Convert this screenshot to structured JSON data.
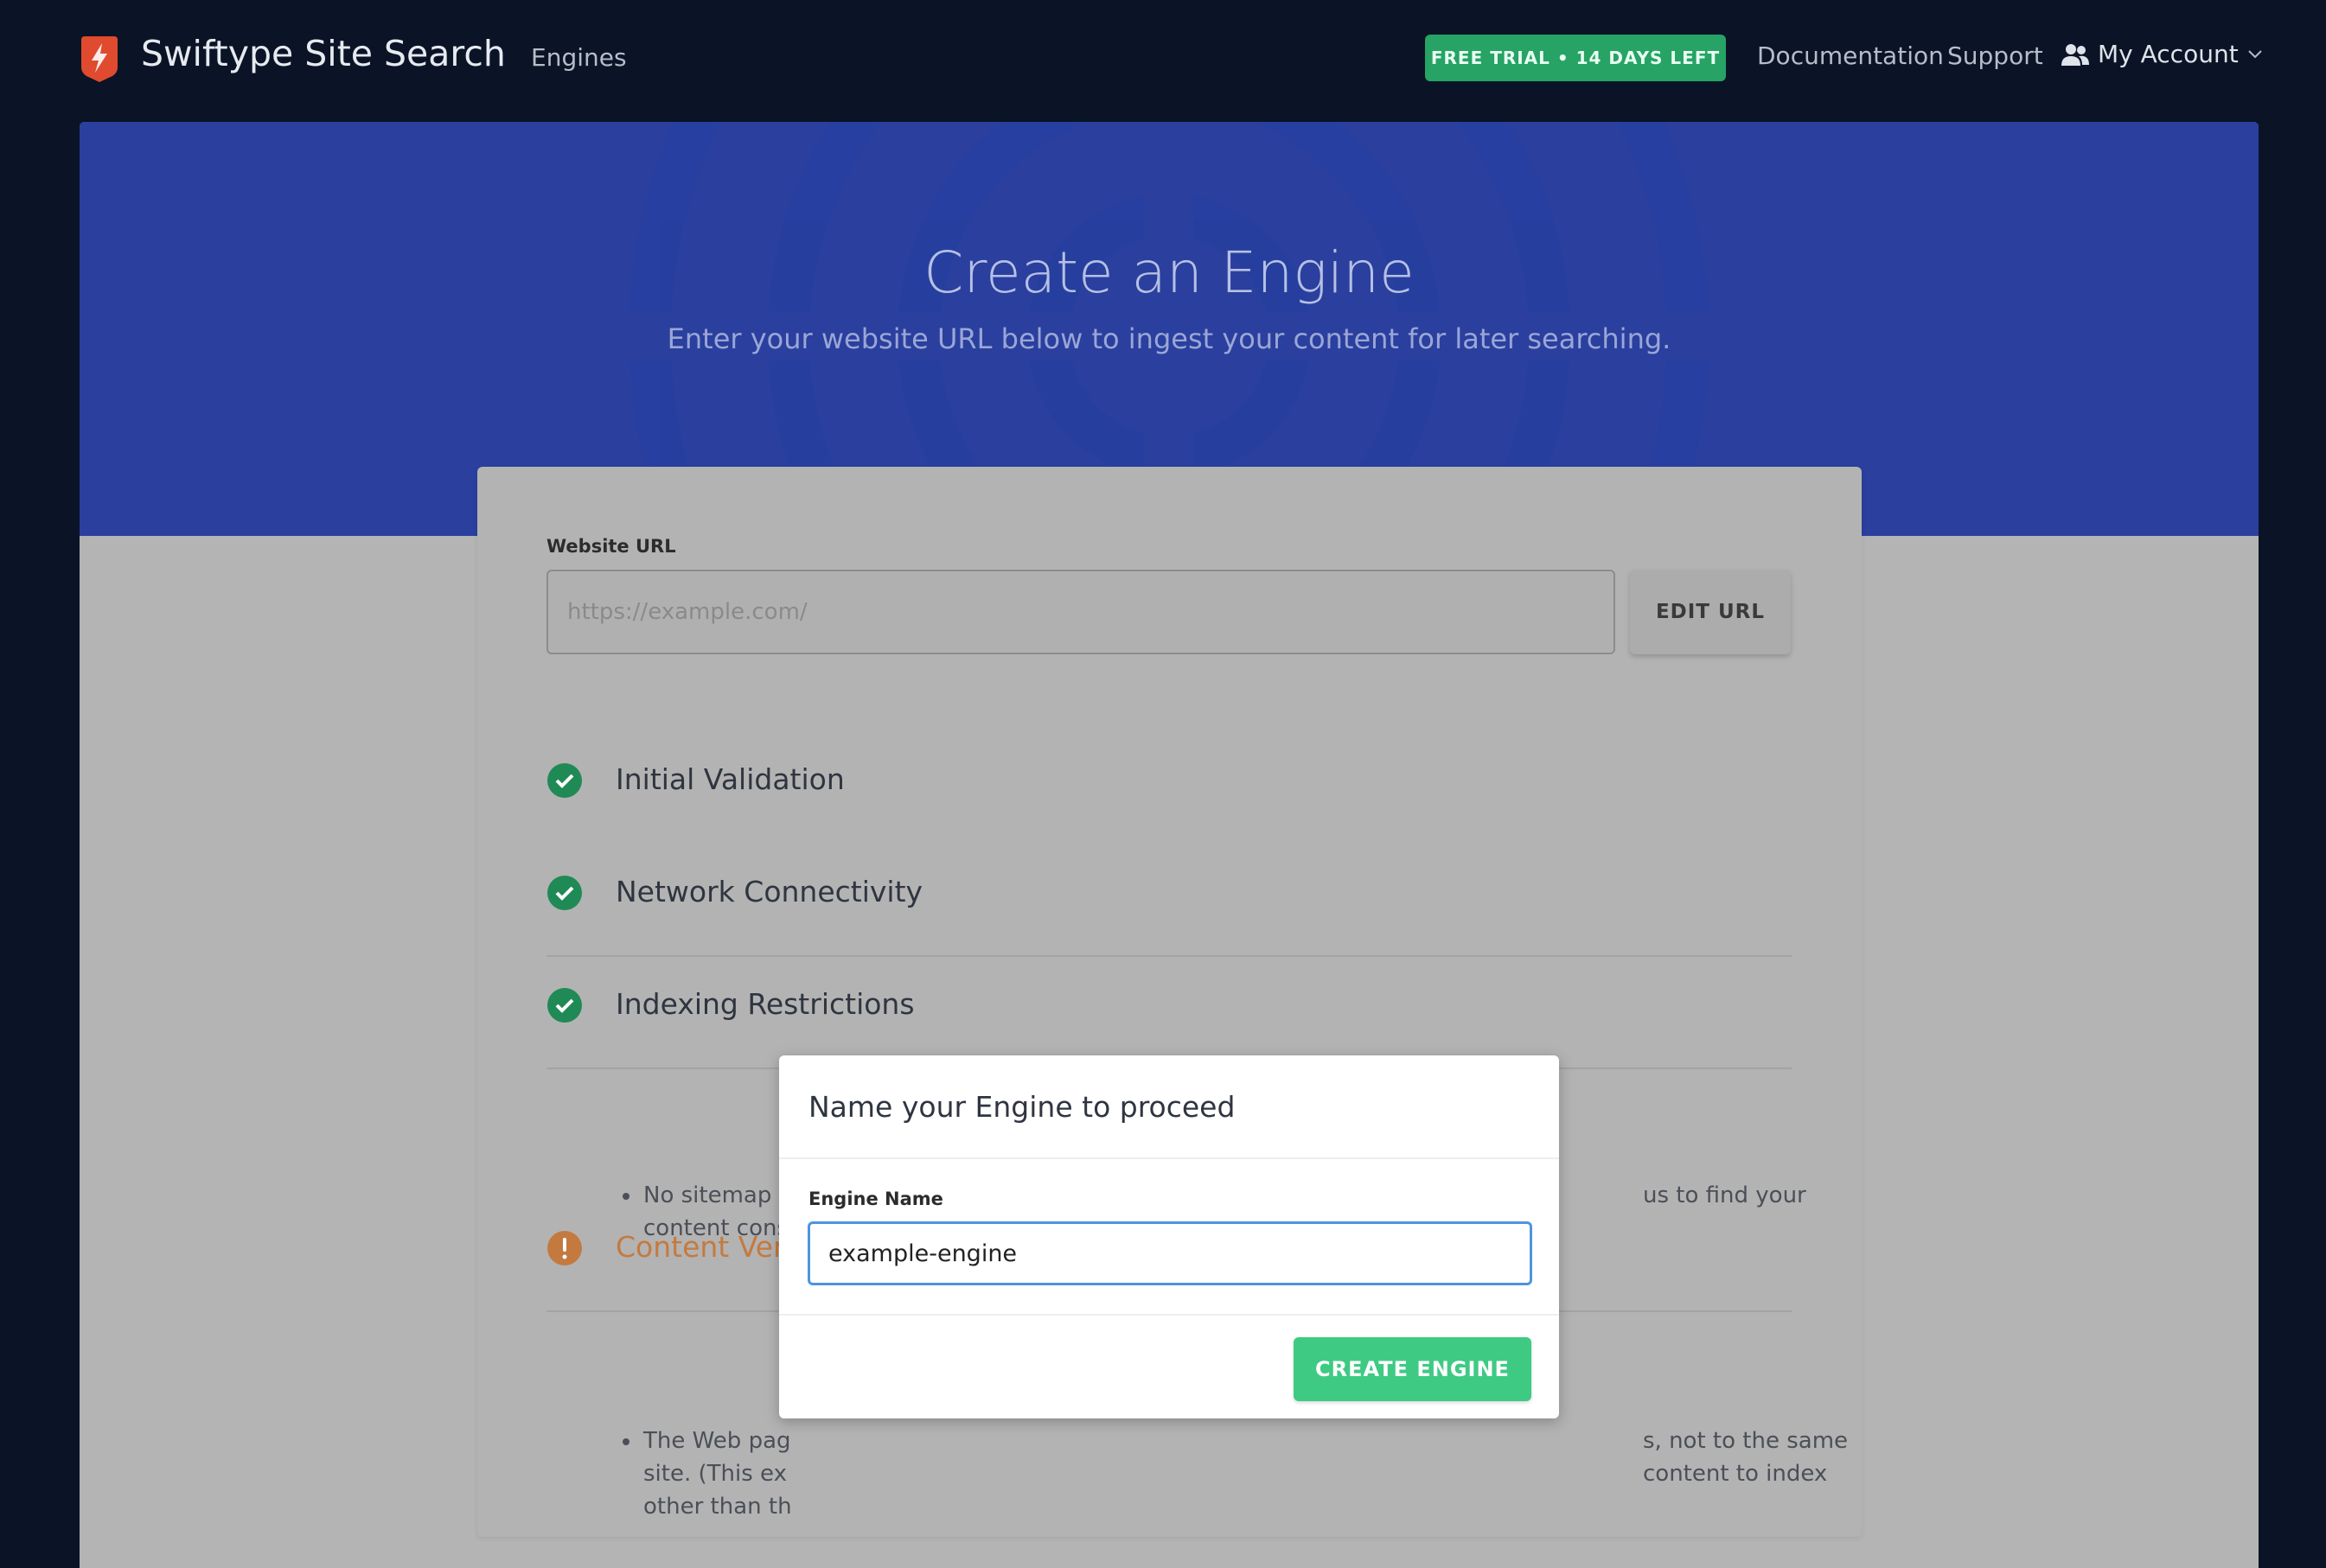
{
  "nav": {
    "brand": "Swiftype Site Search",
    "engines": "Engines",
    "trial_badge": "FREE TRIAL • 14 DAYS LEFT",
    "documentation": "Documentation",
    "support": "Support",
    "account": "My Account"
  },
  "hero": {
    "title": "Create an Engine",
    "subtitle": "Enter your website URL below to ingest your content for later searching."
  },
  "form": {
    "url_label": "Website URL",
    "url_placeholder": "https://example.com/",
    "edit_url": "EDIT URL"
  },
  "checks": [
    {
      "title": "Initial Validation",
      "status": "success"
    },
    {
      "title": "Network Connectivity",
      "status": "success"
    },
    {
      "title": "Indexing Restrictions",
      "status": "success",
      "bullets": [
        [
          "No sitemap f",
          "us to find your"
        ],
        [
          "content cons",
          ""
        ]
      ]
    },
    {
      "title": "Content Ver",
      "status": "warning",
      "bullets": [
        [
          "The Web pag",
          "s, not to the same"
        ],
        [
          "site. (This ex",
          "content to index"
        ],
        [
          "other than th",
          ""
        ]
      ]
    }
  ],
  "modal": {
    "title": "Name your Engine to proceed",
    "field_label": "Engine Name",
    "field_value": "example-engine",
    "create_button": "CREATE ENGINE"
  },
  "colors": {
    "nav_bg": "#0a1426",
    "hero_bg": "#2a3f9e",
    "success": "#1f8a55",
    "warning": "#c47a3f",
    "trial_badge": "#26a365",
    "primary_button": "#3fca84",
    "focus_ring": "#4e94e0"
  }
}
